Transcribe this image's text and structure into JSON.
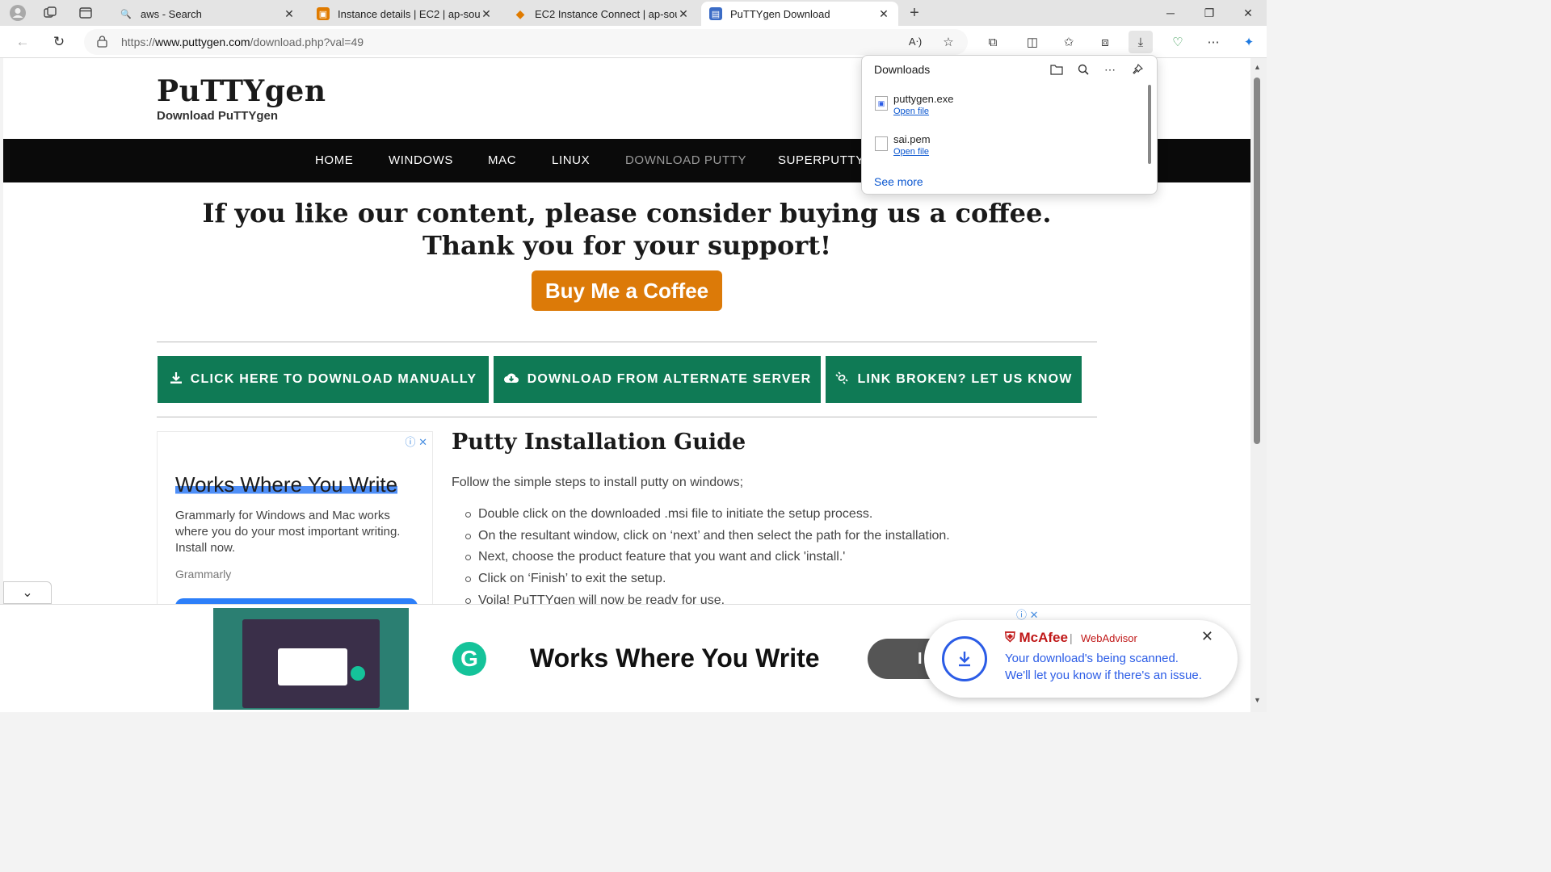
{
  "browser": {
    "tabs": [
      {
        "title": "aws - Search",
        "favicon": "search-icon",
        "active": false
      },
      {
        "title": "Instance details | EC2 | ap-south-",
        "favicon": "aws-icon",
        "active": false
      },
      {
        "title": "EC2 Instance Connect | ap-south",
        "favicon": "aws-cube-icon",
        "active": false
      },
      {
        "title": "PuTTYgen Download",
        "favicon": "putty-icon",
        "active": true
      }
    ],
    "url_prefix": "https://",
    "url_domain": "www.puttygen.com",
    "url_path": "/download.php?val=49"
  },
  "downloads_panel": {
    "title": "Downloads",
    "items": [
      {
        "name": "puttygen.exe",
        "action": "Open file"
      },
      {
        "name": "sai.pem",
        "action": "Open file"
      }
    ],
    "see_more": "See more"
  },
  "site": {
    "logo": "PuTTYgen",
    "tagline": "Download PuTTYgen",
    "nav": [
      "HOME",
      "WINDOWS",
      "MAC",
      "LINUX",
      "DOWNLOAD PUTTY",
      "SUPERPUTTY"
    ],
    "headline_1": "If you like our content, please consider buying us a coffee.",
    "headline_2": "Thank you for your support!",
    "coffee_button": "Buy Me a Coffee",
    "download_buttons": [
      "CLICK HERE TO DOWNLOAD MANUALLY",
      "DOWNLOAD FROM ALTERNATE SERVER",
      "LINK BROKEN? LET US KNOW"
    ],
    "guide_title": "Putty Installation Guide",
    "guide_intro": "Follow the simple steps to install putty on windows;",
    "guide_steps": [
      "Double click on the downloaded .msi file to initiate the setup process.",
      "On the resultant window, click on ‘next’ and then select the path for the installation.",
      "Next, choose the product feature that you want and click 'install.'",
      "Click on ‘Finish’ to exit the setup.",
      "Voila! PuTTYgen will now be ready for use."
    ]
  },
  "side_ad": {
    "title": "Works Where You Write",
    "description": "Grammarly for Windows and Mac works where you do your most important writing. Install now.",
    "brand": "Grammarly"
  },
  "bottom_ad": {
    "title": "Works Where You Write",
    "button_initial": "I"
  },
  "mcafee": {
    "brand": "McAfee",
    "product": "WebAdvisor",
    "line1": "Your download's being scanned.",
    "line2": "We'll let you know if there's an issue."
  },
  "colors": {
    "download_green": "#0f7a55",
    "coffee_orange": "#dc7a08",
    "mcafee_red": "#c01818",
    "mcafee_blue": "#2b5ce6"
  }
}
